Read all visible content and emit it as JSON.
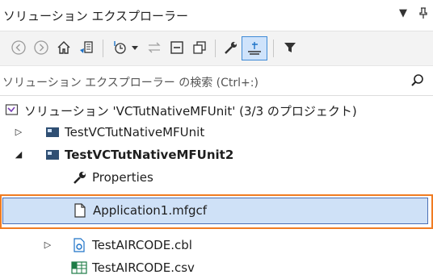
{
  "panel": {
    "title": "ソリューション エクスプローラー",
    "dropdown_glyph": "▼",
    "pin_glyph": "ᚚ"
  },
  "toolbar": {
    "buttons": [
      {
        "icon": "back-icon"
      },
      {
        "icon": "forward-icon"
      },
      {
        "icon": "home-icon"
      },
      {
        "icon": "switch-views-icon"
      },
      {
        "icon": "pending-changes-filter-icon"
      },
      {
        "icon": "sync-with-active-document-icon"
      },
      {
        "icon": "collapse-all-icon"
      },
      {
        "icon": "show-all-files-icon"
      },
      {
        "icon": "properties-wrench-icon"
      },
      {
        "icon": "preview-selected-items-icon"
      },
      {
        "icon": "filter-icon"
      }
    ]
  },
  "search": {
    "placeholder": "ソリューション エクスプローラー の検索 (Ctrl+:)"
  },
  "tree": {
    "items": [
      {
        "label": "ソリューション 'VCTutNativeMFUnit' (3/3 のプロジェクト)",
        "icon": "solution-icon",
        "expander": ""
      },
      {
        "label": "TestVCTutNativeMFUnit",
        "icon": "project-icon",
        "expander": "▷"
      },
      {
        "label": "TestVCTutNativeMFUnit2",
        "icon": "project-icon",
        "expander": "◢"
      },
      {
        "label": "Properties",
        "icon": "wrench-icon",
        "expander": ""
      },
      {
        "label": "Application1.mfgcf",
        "icon": "file-icon",
        "expander": ""
      },
      {
        "label": "TestAIRCODE.cbl",
        "icon": "cobol-file-icon",
        "expander": "▷"
      },
      {
        "label": "TestAIRCODE.csv",
        "icon": "csv-file-icon",
        "expander": ""
      }
    ]
  },
  "colors": {
    "selection_fill": "#cfe1f7",
    "selection_border": "#4a6fb5",
    "callout_outline": "#f07c22",
    "toolbar_bg": "#f3f3f3"
  }
}
